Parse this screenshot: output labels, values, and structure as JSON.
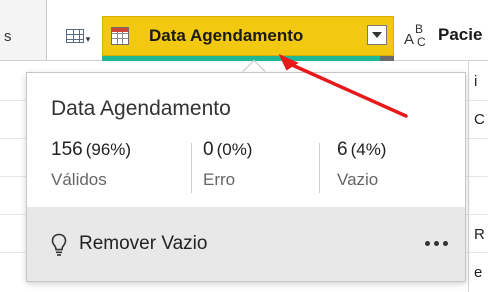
{
  "grid": {
    "prev_column_fragment": "s",
    "selected_column": {
      "title": "Data Agendamento",
      "header_color": "#F2C811",
      "quality_bar_color": "#1FB896"
    },
    "next_column_fragment": "Pacie",
    "next_column_type_icon": {
      "a": "A",
      "b": "B",
      "c": "C"
    },
    "row_fragments": [
      "i",
      "C",
      "",
      "",
      "",
      "R",
      "e"
    ]
  },
  "popup": {
    "title": "Data Agendamento",
    "stats": [
      {
        "count": "156",
        "pct": "(96%)",
        "label": "Válidos"
      },
      {
        "count": "0",
        "pct": "(0%)",
        "label": "Erro"
      },
      {
        "count": "6",
        "pct": "(4%)",
        "label": "Vazio"
      }
    ],
    "footer_action": "Remover Vazio",
    "footer_action_icon": "lightbulb-icon",
    "more_icon": "more-horizontal-icon"
  },
  "annotation": {
    "arrow_color": "#E8191A"
  }
}
